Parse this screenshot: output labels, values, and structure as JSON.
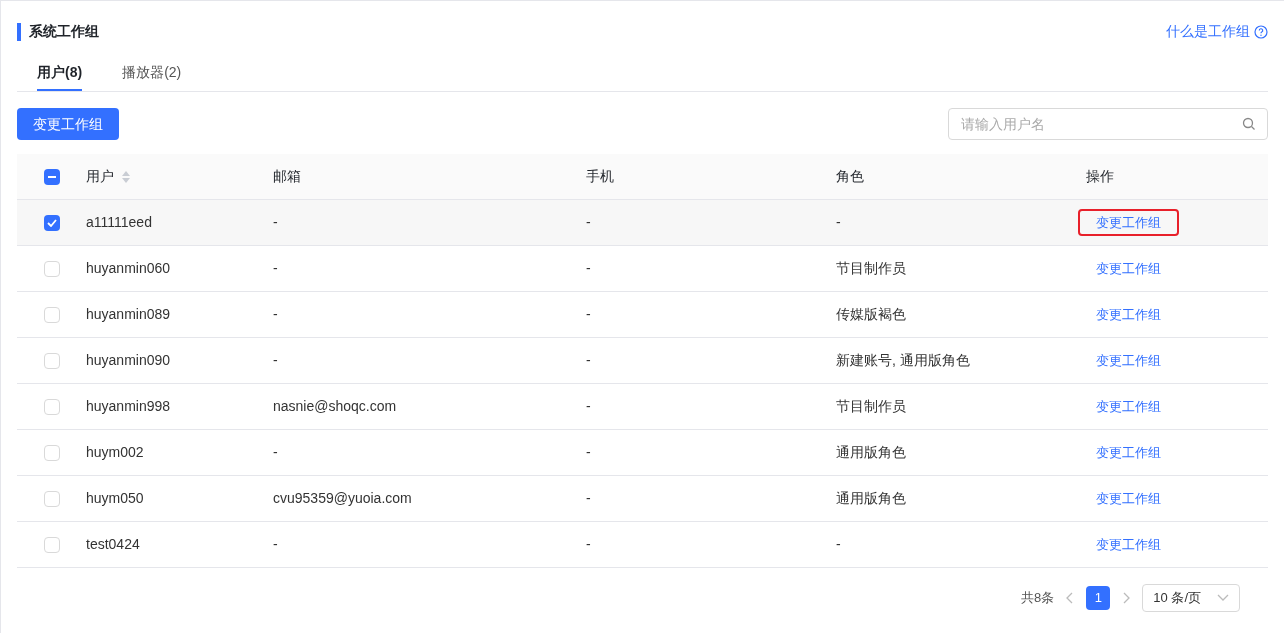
{
  "title": "系统工作组",
  "help_link": "什么是工作组",
  "tabs": [
    {
      "label": "用户(8)",
      "selected": true
    },
    {
      "label": "播放器(2)",
      "selected": false
    }
  ],
  "primary_button": "变更工作组",
  "search": {
    "placeholder": "请输入用户名"
  },
  "table": {
    "select_all": {
      "indeterminate": true
    },
    "columns": [
      {
        "label": "用户",
        "sortable": true
      },
      {
        "label": "邮箱"
      },
      {
        "label": "手机"
      },
      {
        "label": "角色"
      },
      {
        "label": "操作"
      }
    ],
    "rows": [
      {
        "selected": true,
        "user": "a11111eed",
        "email": "-",
        "phone": "-",
        "role": "-",
        "action": "变更工作组",
        "highlighted": true
      },
      {
        "selected": false,
        "user": "huyanmin060",
        "email": "-",
        "phone": "-",
        "role": "节目制作员",
        "action": "变更工作组",
        "highlighted": false
      },
      {
        "selected": false,
        "user": "huyanmin089",
        "email": "-",
        "phone": "-",
        "role": "传媒版褐色",
        "action": "变更工作组",
        "highlighted": false
      },
      {
        "selected": false,
        "user": "huyanmin090",
        "email": "-",
        "phone": "-",
        "role": "新建账号, 通用版角色",
        "action": "变更工作组",
        "highlighted": false
      },
      {
        "selected": false,
        "user": "huyanmin998",
        "email": "nasnie@shoqc.com",
        "phone": "-",
        "role": "节目制作员",
        "action": "变更工作组",
        "highlighted": false
      },
      {
        "selected": false,
        "user": "huym002",
        "email": "-",
        "phone": "-",
        "role": "通用版角色",
        "action": "变更工作组",
        "highlighted": false
      },
      {
        "selected": false,
        "user": "huym050",
        "email": "cvu95359@yuoia.com",
        "phone": "-",
        "role": "通用版角色",
        "action": "变更工作组",
        "highlighted": false
      },
      {
        "selected": false,
        "user": "test0424",
        "email": "-",
        "phone": "-",
        "role": "-",
        "action": "变更工作组",
        "highlighted": false
      }
    ]
  },
  "pagination": {
    "total": "共8条",
    "pages": [
      {
        "label": "1",
        "selected": true
      }
    ],
    "page_size": "10 条/页"
  }
}
